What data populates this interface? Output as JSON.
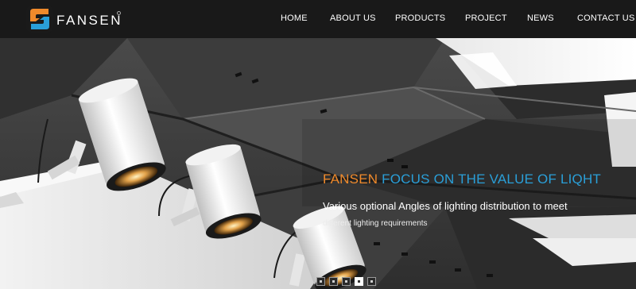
{
  "brand": {
    "logo_text": "FANSEN",
    "logo_colors": {
      "orange": "#f08a2b",
      "blue": "#2a9fd8"
    }
  },
  "nav": {
    "items": [
      {
        "label": "HOME"
      },
      {
        "label": "ABOUT US"
      },
      {
        "label": "PRODUCTS"
      },
      {
        "label": "PROJECT"
      },
      {
        "label": "NEWS"
      },
      {
        "label": "CONTACT US"
      }
    ]
  },
  "hero": {
    "title_brand": "FANSEN",
    "title_rest": "FOCUS ON THE VALUE OF LIQHT",
    "subtitle_line1": "Various optional Angles of lighting distribution to meet",
    "subtitle_line2": "different lighting requirements",
    "slider": {
      "slide_count": 5,
      "active_index": 3
    }
  }
}
